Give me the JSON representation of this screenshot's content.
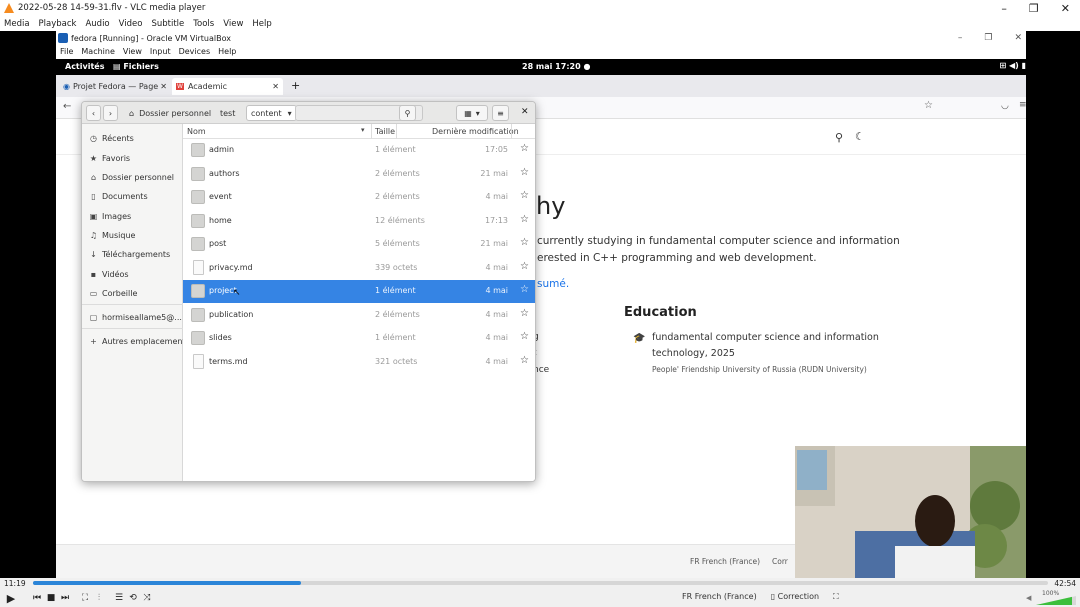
{
  "vlc": {
    "title": "2022-05-28 14-59-31.flv - VLC media player",
    "menu": [
      "Media",
      "Playback",
      "Audio",
      "Video",
      "Subtitle",
      "Tools",
      "View",
      "Help"
    ],
    "current_time": "11:19",
    "total_time": "42:54",
    "progress": 0.264,
    "volume": "100%",
    "status_lang": "FR French (France)",
    "status_correction": "Correction"
  },
  "vbox": {
    "title": "fedora [Running] - Oracle VM VirtualBox",
    "menu": [
      "File",
      "Machine",
      "View",
      "Input",
      "Devices",
      "Help"
    ]
  },
  "gnome": {
    "activities": "Activités",
    "app": "Fichiers",
    "clock": "28 mai  17:20"
  },
  "firefox": {
    "tabs": [
      {
        "label": "Projet Fedora — Page d'a"
      },
      {
        "label": "Academic"
      }
    ]
  },
  "site": {
    "heading_fragment": "hy",
    "line1": "currently studying in fundamental computer science and information",
    "line2": "erested in C++ programming and web development.",
    "resume_link": "sumé.",
    "education_title": "Education",
    "edu_degree_l1": "fundamental computer science and information",
    "edu_degree_l2": "technology, 2025",
    "edu_school": "People' Friendship University of Russia (RUDN University)",
    "left_frag1": "g",
    "left_frag2": "t",
    "left_frag3": "nce",
    "inner_lang": "FR French (France)",
    "inner_corr": "Corr"
  },
  "nautilus": {
    "breadcrumbs": [
      "Dossier personnel",
      "test",
      "content"
    ],
    "sidebar": [
      {
        "icon": "clock-icon",
        "glyph": "◷",
        "label": "Récents"
      },
      {
        "icon": "star-icon",
        "glyph": "★",
        "label": "Favoris"
      },
      {
        "icon": "home-icon",
        "glyph": "⌂",
        "label": "Dossier personnel"
      },
      {
        "icon": "document-icon",
        "glyph": "▯",
        "label": "Documents"
      },
      {
        "icon": "image-icon",
        "glyph": "▣",
        "label": "Images"
      },
      {
        "icon": "music-icon",
        "glyph": "♫",
        "label": "Musique"
      },
      {
        "icon": "download-icon",
        "glyph": "↓",
        "label": "Téléchargements"
      },
      {
        "icon": "video-icon",
        "glyph": "▪",
        "label": "Vidéos"
      },
      {
        "icon": "trash-icon",
        "glyph": "▭",
        "label": "Corbeille"
      },
      {
        "icon": "network-icon",
        "glyph": "▢",
        "label": "hormiseallame5@..."
      },
      {
        "icon": "plus-icon",
        "glyph": "+",
        "label": "Autres emplacements"
      }
    ],
    "columns": {
      "name": "Nom",
      "size": "Taille",
      "modified": "Dernière modification"
    },
    "files": [
      {
        "name": "admin",
        "kind": "folder",
        "size": "1 élément",
        "date": "17:05"
      },
      {
        "name": "authors",
        "kind": "folder",
        "size": "2 éléments",
        "date": "21 mai"
      },
      {
        "name": "event",
        "kind": "folder",
        "size": "2 éléments",
        "date": "4 mai"
      },
      {
        "name": "home",
        "kind": "folder",
        "size": "12 éléments",
        "date": "17:13"
      },
      {
        "name": "post",
        "kind": "folder",
        "size": "5 éléments",
        "date": "21 mai"
      },
      {
        "name": "privacy.md",
        "kind": "file",
        "size": "339 octets",
        "date": "4 mai"
      },
      {
        "name": "project",
        "kind": "folder",
        "size": "1 élément",
        "date": "4 mai",
        "selected": true
      },
      {
        "name": "publication",
        "kind": "folder",
        "size": "2 éléments",
        "date": "4 mai"
      },
      {
        "name": "slides",
        "kind": "folder",
        "size": "1 élément",
        "date": "4 mai"
      },
      {
        "name": "terms.md",
        "kind": "file",
        "size": "321 octets",
        "date": "4 mai"
      }
    ]
  },
  "colors": {
    "selection": "#3584e4",
    "vlc_progress": "#2b85d8",
    "link": "#1a73e8"
  }
}
